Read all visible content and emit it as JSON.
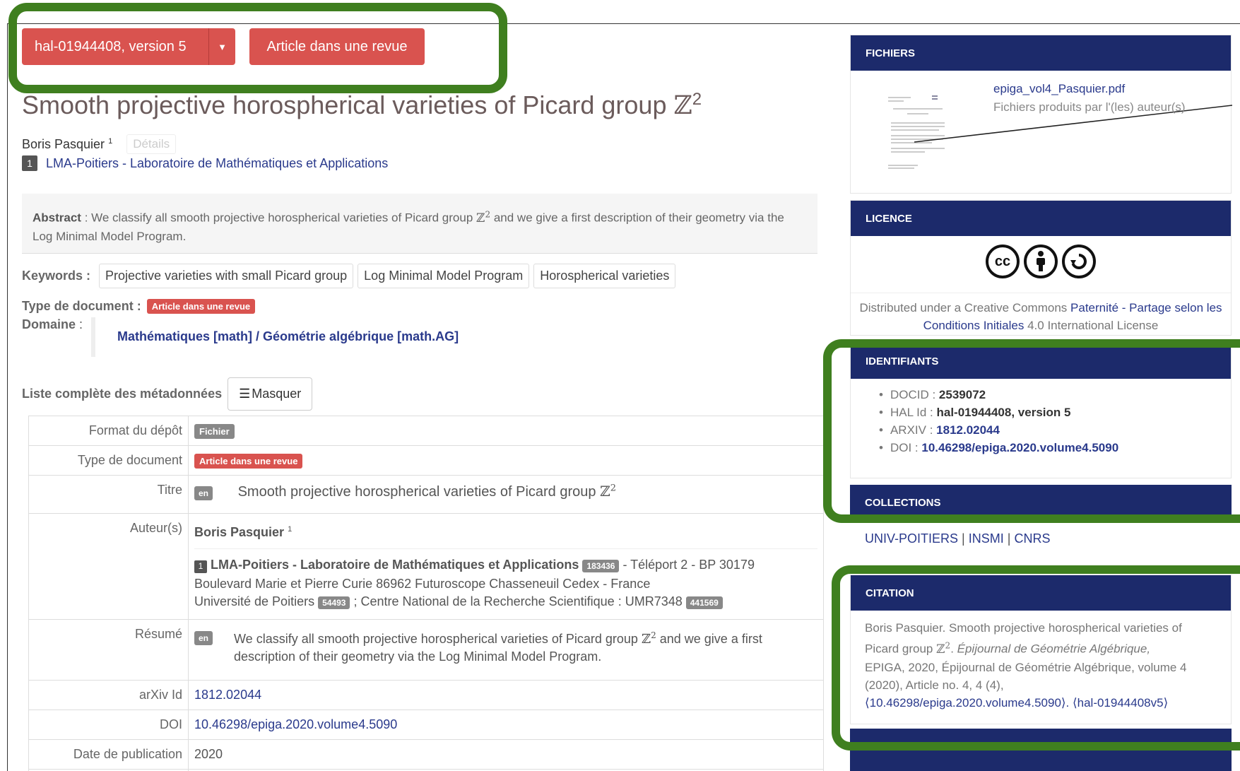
{
  "header": {
    "version_label": "hal-01944408, version 5",
    "doc_type_label": "Article dans une revue"
  },
  "article": {
    "title": "Smooth projective horospherical varieties of Picard group",
    "title_math": "ℤ",
    "title_sup": "2",
    "author": "Boris Pasquier",
    "author_sup": "1",
    "details_label": "Détails",
    "affiliation_num": "1",
    "affiliation": "LMA-Poitiers - Laboratoire de Mathématiques et Applications"
  },
  "abstract": {
    "label": "Abstract",
    "text_before": "We classify all smooth projective horospherical varieties of Picard group",
    "text_after": "and we give a first description of their geometry via the Log Minimal Model Program."
  },
  "keywords": {
    "label": "Keywords",
    "items": [
      "Projective varieties with small Picard group",
      "Log Minimal Model Program",
      "Horospherical varieties"
    ]
  },
  "doctype": {
    "label": "Type de document",
    "value": "Article dans une revue"
  },
  "domaine": {
    "label": "Domaine",
    "value": "Mathématiques [math] / Géométrie algébrique [math.AG]"
  },
  "metadata": {
    "label": "Liste complète des métadonnées",
    "toggle_label": "Masquer",
    "rows": {
      "format": {
        "key": "Format du dépôt",
        "value": "Fichier"
      },
      "type": {
        "key": "Type de document",
        "value": "Article dans une revue"
      },
      "titre": {
        "key": "Titre",
        "lang": "en",
        "value": "Smooth projective horospherical varieties of Picard group"
      },
      "auteurs": {
        "key": "Auteur(s)",
        "author": "Boris Pasquier",
        "author_sup": "1",
        "affil_num": "1",
        "affil_name": "LMA-Poitiers - Laboratoire de Mathématiques et Applications",
        "affil_id": "183436",
        "affil_addr1": "- Téléport 2 - BP 30179",
        "affil_addr2": "Boulevard Marie et Pierre Curie 86962 Futuroscope Chasseneuil Cedex - France",
        "univ": "Université de Poitiers",
        "univ_id": "54493",
        "cnrs": "; Centre National de la Recherche Scientifique : UMR7348",
        "cnrs_id": "441569"
      },
      "resume": {
        "key": "Résumé",
        "lang": "en",
        "text_before": "We classify all smooth projective horospherical varieties of Picard group",
        "text_after": "and we give a first",
        "text_line2": "description of their geometry via the Log Minimal Model Program."
      },
      "arxiv": {
        "key": "arXiv Id",
        "value": "1812.02044"
      },
      "doi": {
        "key": "DOI",
        "value": "10.46298/epiga.2020.volume4.5090"
      },
      "date": {
        "key": "Date de publication",
        "value": "2020"
      }
    }
  },
  "sidebar": {
    "fichiers": {
      "title": "FICHIERS",
      "file_name": "epiga_vol4_Pasquier.pdf",
      "file_desc": "Fichiers produits par l'(les) auteur(s)"
    },
    "licence": {
      "title": "LICENCE",
      "icons": [
        "cc",
        "by",
        "sa"
      ],
      "text_prefix": "Distributed under a Creative Commons",
      "link": "Paternité - Partage selon les Conditions Initiales",
      "text_suffix": "4.0 International License"
    },
    "identifiants": {
      "title": "IDENTIFIANTS",
      "items": [
        {
          "key": "DOCID :",
          "value": "2539072"
        },
        {
          "key": "HAL Id :",
          "value": "hal-01944408, version 5"
        },
        {
          "key": "ARXIV :",
          "value": "1812.02044"
        },
        {
          "key": "DOI :",
          "value": "10.46298/epiga.2020.volume4.5090"
        }
      ]
    },
    "collections": {
      "title": "COLLECTIONS",
      "items": [
        "UNIV-POITIERS",
        "INSMI",
        "CNRS"
      ]
    },
    "citation": {
      "title": "CITATION",
      "line1": "Boris Pasquier. Smooth projective horospherical varieties of",
      "line2_a": "Picard group",
      "line2_journal": "Épijournal de Géométrie Algébrique,",
      "line3": "EPIGA, 2020, Épijournal de Géométrie Algébrique, volume 4",
      "line4": "(2020), Article no. 4, 4 (4),",
      "line5": "⟨10.46298/epiga.2020.volume4.5090⟩. ⟨hal-01944408v5⟩"
    }
  },
  "colors": {
    "accent_red": "#d9534f",
    "panel_navy": "#1c2a6b",
    "annotation_green": "#3f7f1f",
    "link_blue": "#2a3a8c"
  }
}
